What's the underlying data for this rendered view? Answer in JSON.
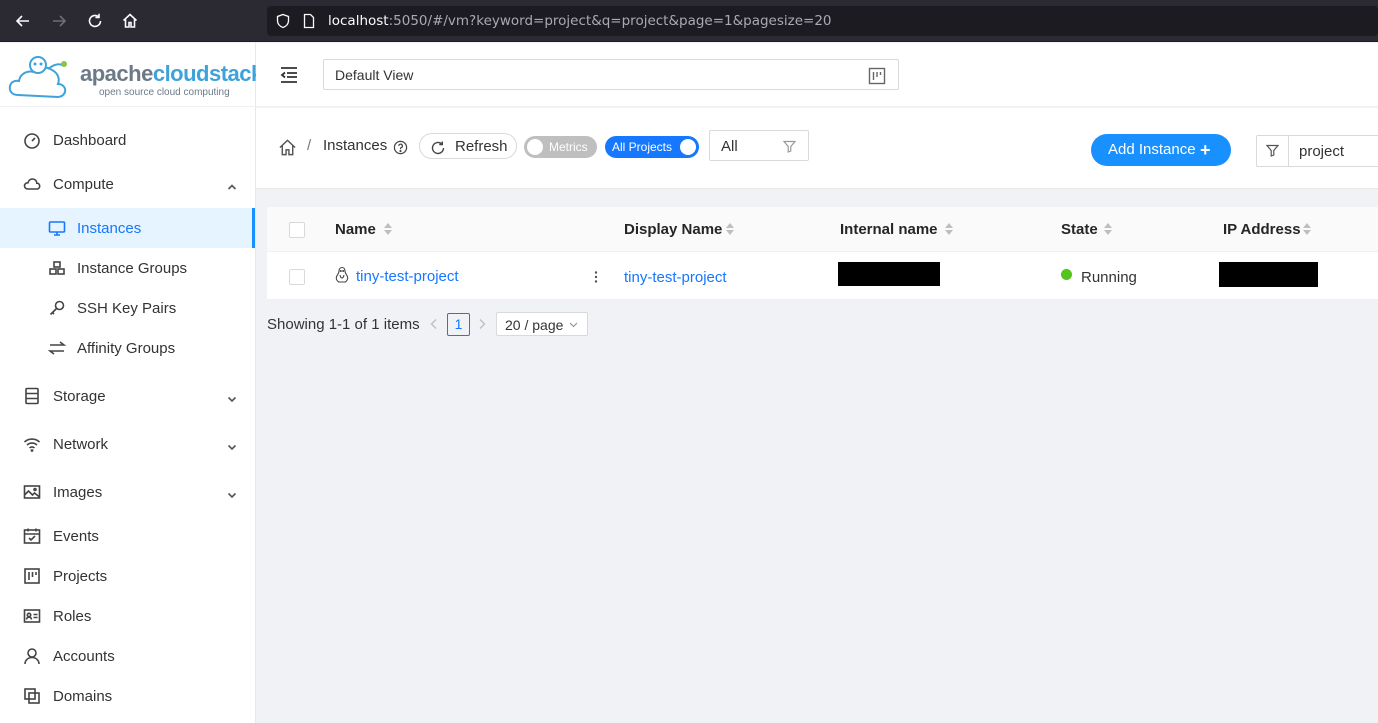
{
  "browser": {
    "url_host": "localhost",
    "url_rest": ":5050/#/vm?keyword=project&q=project&page=1&pagesize=20"
  },
  "logo": {
    "brand_a": "apache",
    "brand_b": "cloudstack",
    "tagline": "open source cloud computing"
  },
  "sidebar": {
    "items": [
      {
        "label": "Dashboard"
      },
      {
        "label": "Compute"
      },
      {
        "label": "Instances"
      },
      {
        "label": "Instance Groups"
      },
      {
        "label": "SSH Key Pairs"
      },
      {
        "label": "Affinity Groups"
      },
      {
        "label": "Storage"
      },
      {
        "label": "Network"
      },
      {
        "label": "Images"
      },
      {
        "label": "Events"
      },
      {
        "label": "Projects"
      },
      {
        "label": "Roles"
      },
      {
        "label": "Accounts"
      },
      {
        "label": "Domains"
      }
    ]
  },
  "header": {
    "view_select": "Default View"
  },
  "toolbar": {
    "breadcrumb_sep": "/",
    "breadcrumb_current": "Instances",
    "refresh_label": "Refresh",
    "metrics_label": "Metrics",
    "all_projects_label": "All Projects",
    "filter_value": "All",
    "add_label": "Add Instance",
    "add_plus": "+",
    "search_value": "project"
  },
  "table": {
    "columns": [
      "Name",
      "Display Name",
      "Internal name",
      "State",
      "IP Address"
    ],
    "rows": [
      {
        "name": "tiny-test-project",
        "display_name": "tiny-test-project",
        "state": "Running"
      }
    ]
  },
  "pagination": {
    "total_text": "Showing 1-1 of 1 items",
    "current_page": "1",
    "page_size": "20 / page"
  },
  "colors": {
    "primary": "#1677ff",
    "running": "#52c41a"
  }
}
